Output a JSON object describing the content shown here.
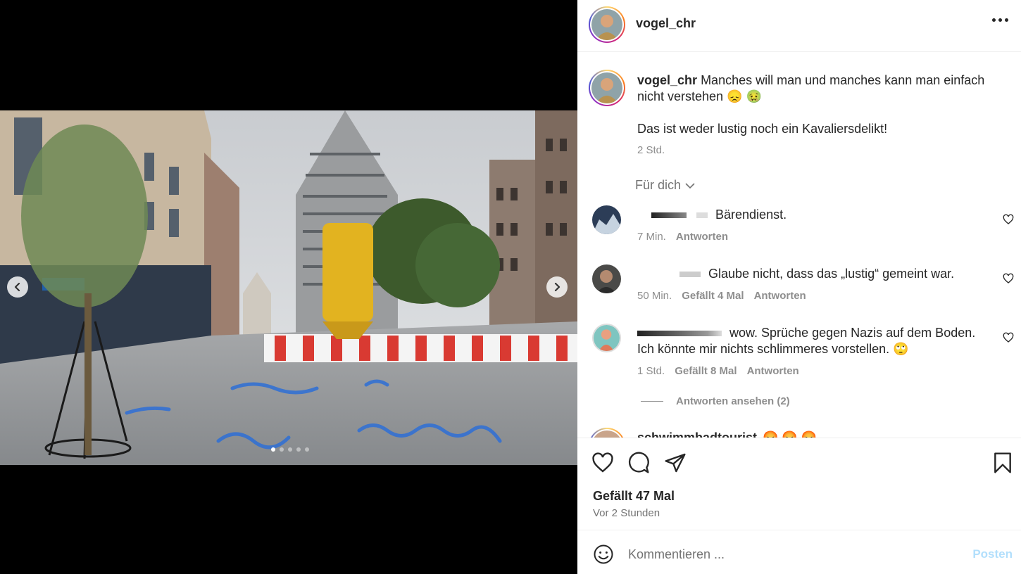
{
  "media": {
    "carousel_count": 5,
    "carousel_active": 1,
    "prev_icon": "chevron-left-icon",
    "next_icon": "chevron-right-icon"
  },
  "header": {
    "username": "vogel_chr",
    "more_icon": "more-horizontal-icon"
  },
  "caption": {
    "username": "vogel_chr",
    "text": "Manches will man und manches kann man einfach nicht verstehen 😞 🤢",
    "text_2": "Das ist weder lustig noch ein Kavaliersdelikt!",
    "time": "2 Std."
  },
  "filter": {
    "label": "Für dich"
  },
  "comments": [
    {
      "text": "Bärendienst.",
      "time": "7 Min.",
      "likes": "",
      "reply": "Antworten"
    },
    {
      "text": "Glaube nicht, dass das „lustig“ gemeint war.",
      "time": "50 Min.",
      "likes": "Gefällt 4 Mal",
      "reply": "Antworten"
    },
    {
      "text": "wow. Sprüche gegen Nazis auf dem Boden. Ich könnte mir nichts schlimmeres vorstellen. 🙄",
      "time": "1 Std.",
      "likes": "Gefällt 8 Mal",
      "reply": "Antworten"
    }
  ],
  "view_replies": "Antworten ansehen (2)",
  "partial_comment": {
    "username": "schwimmbadtourist",
    "emojis": "😡 😡 😡"
  },
  "actions": {
    "like_icon": "heart-icon",
    "comment_icon": "comment-icon",
    "share_icon": "send-icon",
    "save_icon": "bookmark-icon"
  },
  "likes": "Gefällt 47 Mal",
  "post_time": "Vor 2 Stunden",
  "composer": {
    "placeholder": "Kommentieren ...",
    "post_label": "Posten",
    "emoji_icon": "emoji-smile-icon"
  },
  "colors": {
    "link_disabled": "#b2dffc",
    "muted": "#8e8e8e",
    "text": "#262626"
  }
}
